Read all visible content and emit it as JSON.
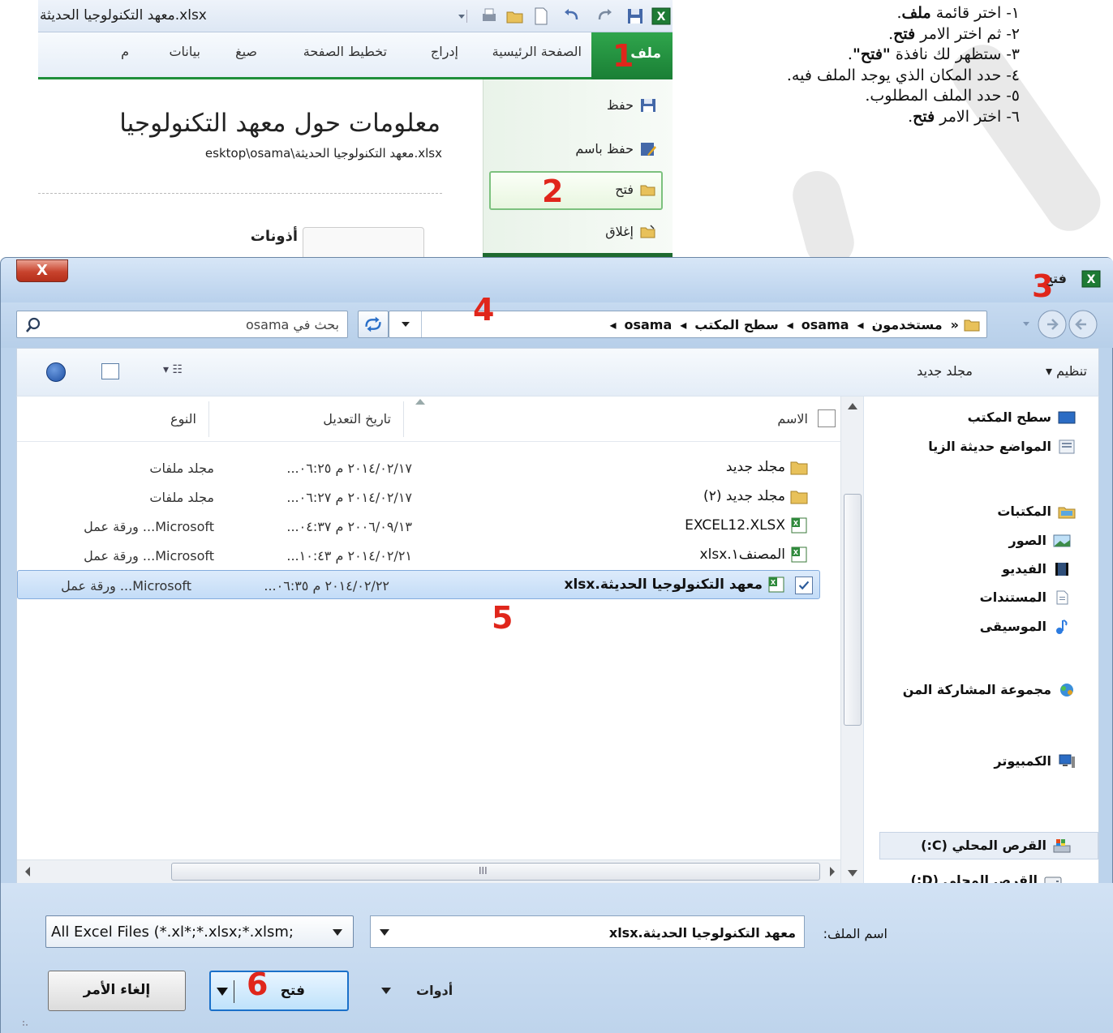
{
  "instructions": [
    {
      "prefix": "١- اختر قائمة ",
      "bold": "ملف",
      "suffix": "."
    },
    {
      "prefix": "٢- ثم اختر الامر ",
      "bold": "فتح",
      "suffix": "."
    },
    {
      "prefix": "٣- ستظهر لك نافذة ",
      "bold": "\"فتح\"",
      "suffix": "."
    },
    {
      "prefix": "٤- حدد المكان الذي يوجد الملف فيه.",
      "bold": "",
      "suffix": ""
    },
    {
      "prefix": "٥- حدد الملف المطلوب.",
      "bold": "",
      "suffix": ""
    },
    {
      "prefix": "٦- اختر الامر ",
      "bold": "فتح",
      "suffix": "."
    }
  ],
  "excel": {
    "window_title": "معهد التكنولوجيا الحديثة.xlsx",
    "tabs": {
      "file": "ملف",
      "home": "الصفحة الرئيسية",
      "insert": "إدراج",
      "page_layout": "تخطيط الصفحة",
      "formulas": "صيغ",
      "data": "بيانات",
      "more": "م"
    },
    "backstage": {
      "save": "حفظ",
      "save_as": "حفظ باسم",
      "open": "فتح",
      "close": "إغلاق",
      "info_title": "معلومات حول معهد التكنولوجيا",
      "info_path": "esktop\\osama\\معهد التكنولوجيا الحديثة.xlsx",
      "permissions_title": "أذونات"
    }
  },
  "dialog": {
    "title": "فتح",
    "close_label": "X",
    "search_placeholder": "بحث في osama",
    "breadcrumbs": [
      "«",
      "مستخدمون",
      "osama",
      "سطح المكتب",
      "osama"
    ],
    "toolbar": {
      "organize": "تنظيم ▾",
      "new_folder": "مجلد جديد",
      "views": "▾ ☷"
    },
    "nav": {
      "desktop": "سطح المكتب",
      "recent": "المواضع حديثة الزيا",
      "libraries": "المكتبات",
      "pictures": "الصور",
      "videos": "الفيديو",
      "documents": "المستندات",
      "music": "الموسيقى",
      "homegroup": "مجموعة المشاركة المن",
      "computer": "الكمبيوتر",
      "drive_c": "القرص المحلي (C:)",
      "drive_d": "القرص المحلي (D:)"
    },
    "columns": {
      "name": "الاسم",
      "date": "تاريخ التعديل",
      "type": "النوع"
    },
    "files": [
      {
        "name": "مجلد جديد",
        "date": "٢٠١٤/٠٢/١٧ م ٠٦:٢٥...",
        "type": "مجلد ملفات",
        "kind": "folder"
      },
      {
        "name": "مجلد جديد (٢)",
        "date": "٢٠١٤/٠٢/١٧ م ٠٦:٢٧...",
        "type": "مجلد ملفات",
        "kind": "folder"
      },
      {
        "name": "EXCEL12.XLSX",
        "date": "٢٠٠٦/٠٩/١٣ م ٠٤:٣٧...",
        "type": "Microsoft... ورقة عمل",
        "kind": "excel"
      },
      {
        "name": "المصنف١.xlsx",
        "date": "٢٠١٤/٠٢/٢١ م ١٠:٤٣...",
        "type": "Microsoft... ورقة عمل",
        "kind": "excel"
      },
      {
        "name": "معهد التكنولوجيا الحديثة.xlsx",
        "date": "٢٠١٤/٠٢/٢٢ م ٠٦:٣٥...",
        "type": "Microsoft... ورقة عمل",
        "kind": "excel",
        "selected": true
      }
    ],
    "hscroll_glyph": "III",
    "filename_label": "اسم الملف:",
    "filename_value": "معهد التكنولوجيا الحديثة.xlsx",
    "filetype_value": "All Excel Files (*.xl*;*.xlsx;*.xlsm;",
    "tools_label": "أدوات",
    "open_button": "فتح",
    "cancel_button": "إلغاء الأمر"
  },
  "steps": [
    "1",
    "2",
    "3",
    "4",
    "5",
    "6"
  ],
  "colors": {
    "step": "#e0261b",
    "excel_green": "#1f8f3a",
    "selection": "#c3dcf7"
  }
}
